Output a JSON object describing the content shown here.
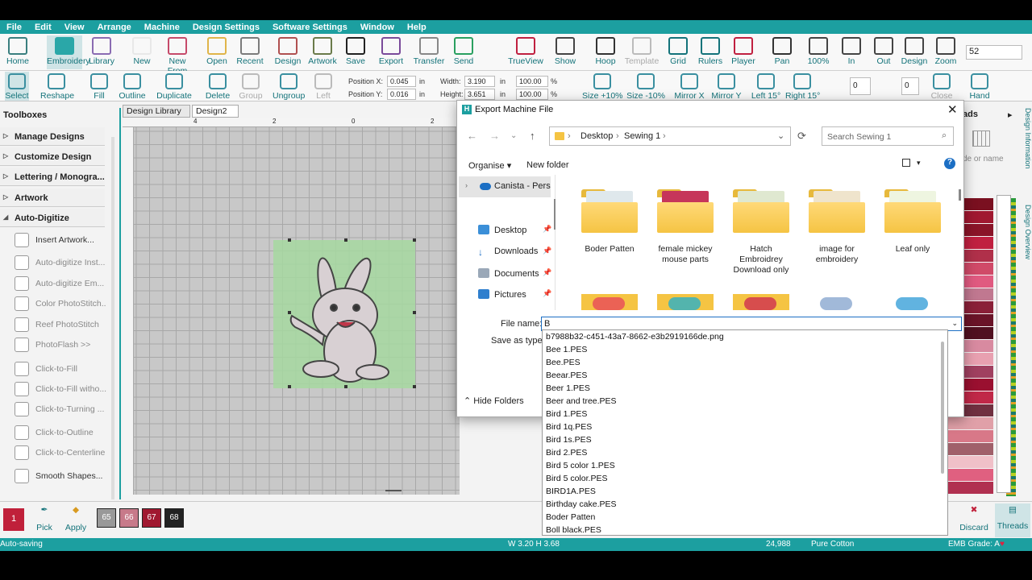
{
  "menu": [
    "File",
    "Edit",
    "View",
    "Arrange",
    "Machine",
    "Design Settings",
    "Software Settings",
    "Window",
    "Help"
  ],
  "ribbon_top": [
    {
      "label": "Home",
      "icon": "home-icon"
    },
    {
      "label": "Embroidery",
      "icon": "hatch-embroidery-icon",
      "selected": true
    },
    {
      "label": "Library",
      "icon": "library-icon"
    },
    {
      "label": "New",
      "icon": "new-file-icon"
    },
    {
      "label": "New From",
      "icon": "new-from-icon"
    },
    {
      "label": "Open",
      "icon": "open-folder-icon"
    },
    {
      "label": "Recent",
      "icon": "recent-icon"
    },
    {
      "label": "Design",
      "icon": "design-icon"
    },
    {
      "label": "Artwork",
      "icon": "artwork-icon"
    },
    {
      "label": "Save",
      "icon": "save-icon"
    },
    {
      "label": "Export",
      "icon": "export-icon"
    },
    {
      "label": "Transfer",
      "icon": "transfer-icon"
    },
    {
      "label": "Send",
      "icon": "send-icon"
    },
    {
      "label": "TrueView",
      "icon": "trueview-icon"
    },
    {
      "label": "Show",
      "icon": "show-icon"
    },
    {
      "label": "Hoop",
      "icon": "hoop-icon"
    },
    {
      "label": "Template",
      "icon": "template-icon"
    },
    {
      "label": "Grid",
      "icon": "grid-icon"
    },
    {
      "label": "Rulers",
      "icon": "rulers-icon"
    },
    {
      "label": "Player",
      "icon": "player-icon"
    },
    {
      "label": "Pan",
      "icon": "pan-icon"
    },
    {
      "label": "100%",
      "icon": "zoom-100-icon"
    },
    {
      "label": "In",
      "icon": "zoom-in-icon"
    },
    {
      "label": "Out",
      "icon": "zoom-out-icon"
    },
    {
      "label": "Design",
      "icon": "zoom-design-icon"
    },
    {
      "label": "Zoom",
      "icon": "zoom-icon"
    }
  ],
  "zoom_value": "52",
  "ribbon_bottom": [
    {
      "label": "Select"
    },
    {
      "label": "Reshape"
    },
    {
      "label": "Fill"
    },
    {
      "label": "Outline"
    },
    {
      "label": "Duplicate"
    },
    {
      "label": "Delete"
    },
    {
      "label": "Group"
    },
    {
      "label": "Ungroup"
    },
    {
      "label": "Left"
    }
  ],
  "position": {
    "x_label": "Position X:",
    "x": "0.045",
    "y_label": "Position Y:",
    "y": "0.016",
    "unit": "in"
  },
  "size": {
    "w_label": "Width:",
    "w": "3.190",
    "h_label": "Height:",
    "h": "3.651",
    "unit": "in",
    "pw": "100.00",
    "ph": "100.00",
    "pct": "%"
  },
  "ribbon_bottom_right": [
    {
      "label": "Size +10%"
    },
    {
      "label": "Size -10%"
    },
    {
      "label": "Mirror X"
    },
    {
      "label": "Mirror Y"
    },
    {
      "label": "Left 15°"
    },
    {
      "label": "Right 15°"
    },
    {
      "label": "Close"
    },
    {
      "label": "Hand"
    }
  ],
  "angle_value": "0",
  "slant_value": "0",
  "toolboxes": {
    "title": "Toolboxes",
    "categories": [
      "Manage Designs",
      "Customize Design",
      "Lettering / Monogra...",
      "Artwork",
      "Auto-Digitize"
    ],
    "items": [
      "Insert Artwork...",
      "Auto-digitize Inst...",
      "Auto-digitize Em...",
      "Color PhotoStitch...",
      "Reef PhotoStitch",
      "PhotoFlash >>",
      "Click-to-Fill",
      "Click-to-Fill witho...",
      "Click-to-Turning ...",
      "Click-to-Outline",
      "Click-to-Centerline",
      "Smooth Shapes..."
    ]
  },
  "doc_tabs": [
    "Design Library",
    "Design2"
  ],
  "ruler_marks": [
    "4",
    "2",
    "0",
    "2"
  ],
  "dialog": {
    "title": "Export Machine File",
    "breadcrumb": [
      "Desktop",
      "Sewing 1"
    ],
    "search_placeholder": "Search Sewing 1",
    "organise": "Organise",
    "new_folder": "New folder",
    "nav": [
      "Canista - Person",
      "Desktop",
      "Downloads",
      "Documents",
      "Pictures"
    ],
    "folders": [
      "Boder Patten",
      "female mickey mouse parts",
      "Hatch Embroidrey Download only",
      "image for embroidery",
      "Leaf only"
    ],
    "file_name_label": "File name:",
    "file_name_value": "B",
    "save_as_label": "Save as type:",
    "hide_folders": "Hide Folders",
    "suggestions": [
      "b7988b32-c451-43a7-8662-e3b2919166de.png",
      "Bee 1.PES",
      "Bee.PES",
      "Beear.PES",
      "Beer 1.PES",
      "Beer and tree.PES",
      "Bird 1.PES",
      "Bird 1q.PES",
      "Bird 1s.PES",
      "Bird 2.PES",
      "Bird 5 color 1.PES",
      "Bird 5 color.PES",
      "BIRD1A.PES",
      "Birthday cake.PES",
      "Boder Patten",
      "Boll black.PES"
    ]
  },
  "right_panel": {
    "header": "ads",
    "search_placeholder": "de or name",
    "tabs": [
      "Design Information",
      "Design Overview"
    ]
  },
  "bottom": {
    "current": "1",
    "pick": "Pick",
    "apply": "Apply",
    "swatches": [
      "65",
      "66",
      "67",
      "68"
    ],
    "discard": "Discard",
    "threads": "Threads"
  },
  "status": {
    "left": "Auto-saving",
    "dims": "W 3.20 H 3.68",
    "stitches": "24,988",
    "thread": "Pure Cotton",
    "grade": "EMB Grade: A"
  },
  "colors": {
    "accent": "#1c9fa0",
    "link": "#14737a"
  }
}
